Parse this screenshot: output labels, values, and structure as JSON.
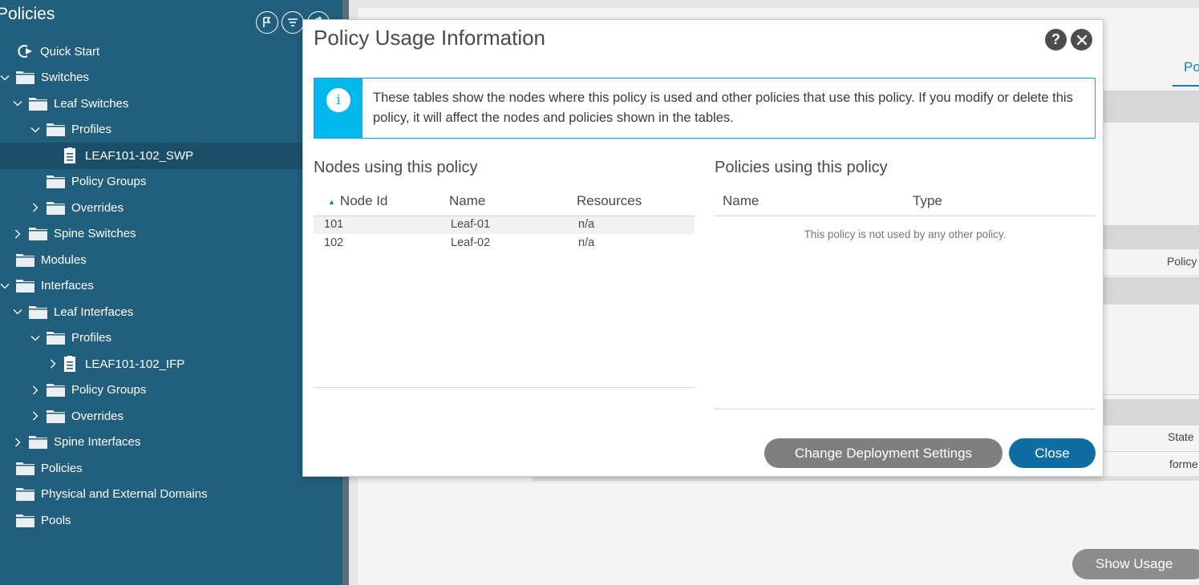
{
  "sidebar": {
    "title": "Policies",
    "items": [
      {
        "label": "Quick Start",
        "level": 0,
        "chevron": "none",
        "icon": "quick-start-icon"
      },
      {
        "label": "Switches",
        "level": 0,
        "chevron": "down",
        "icon": "folder-icon"
      },
      {
        "label": "Leaf Switches",
        "level": 1,
        "chevron": "down",
        "icon": "folder-icon"
      },
      {
        "label": "Profiles",
        "level": 2,
        "chevron": "down",
        "icon": "folder-icon"
      },
      {
        "label": "LEAF101-102_SWP",
        "level": 3,
        "chevron": "none",
        "icon": "document-icon",
        "selected": true
      },
      {
        "label": "Policy Groups",
        "level": 2,
        "chevron": "none",
        "icon": "folder-icon"
      },
      {
        "label": "Overrides",
        "level": 2,
        "chevron": "right",
        "icon": "folder-icon"
      },
      {
        "label": "Spine Switches",
        "level": 1,
        "chevron": "right",
        "icon": "folder-icon"
      },
      {
        "label": "Modules",
        "level": 0,
        "chevron": "none",
        "icon": "folder-icon"
      },
      {
        "label": "Interfaces",
        "level": 0,
        "chevron": "down",
        "icon": "folder-icon"
      },
      {
        "label": "Leaf Interfaces",
        "level": 1,
        "chevron": "down",
        "icon": "folder-icon"
      },
      {
        "label": "Profiles",
        "level": 2,
        "chevron": "down",
        "icon": "folder-icon"
      },
      {
        "label": "LEAF101-102_IFP",
        "level": 3,
        "chevron": "right",
        "icon": "document-icon"
      },
      {
        "label": "Policy Groups",
        "level": 2,
        "chevron": "right",
        "icon": "folder-icon"
      },
      {
        "label": "Overrides",
        "level": 2,
        "chevron": "right",
        "icon": "folder-icon"
      },
      {
        "label": "Spine Interfaces",
        "level": 1,
        "chevron": "right",
        "icon": "folder-icon"
      },
      {
        "label": "Policies",
        "level": 0,
        "chevron": "none",
        "icon": "folder-icon"
      },
      {
        "label": "Physical and External Domains",
        "level": 0,
        "chevron": "none",
        "icon": "folder-icon"
      },
      {
        "label": "Pools",
        "level": 0,
        "chevron": "none",
        "icon": "folder-icon"
      }
    ]
  },
  "background": {
    "tab_label": "Po",
    "col_policy": "Policy",
    "col_state": "State",
    "cell_forme": "forme",
    "show_usage_label": "Show Usage"
  },
  "modal": {
    "title": "Policy Usage Information",
    "help_label": "?",
    "info_text": "These tables show the nodes where this policy is used and other policies that use this policy. If you modify or delete this policy, it will affect the nodes and policies shown in the tables.",
    "nodes": {
      "title": "Nodes using this policy",
      "columns": [
        "Node Id",
        "Name",
        "Resources"
      ],
      "rows": [
        {
          "node_id": "101",
          "name": "Leaf-01",
          "resources": "n/a"
        },
        {
          "node_id": "102",
          "name": "Leaf-02",
          "resources": "n/a"
        }
      ]
    },
    "policies": {
      "title": "Policies using this policy",
      "columns": [
        "Name",
        "Type"
      ],
      "empty_message": "This policy is not used by any other policy."
    },
    "buttons": {
      "change_deployment": "Change Deployment Settings",
      "close": "Close"
    }
  },
  "colors": {
    "sidebar_bg": "#215f7c",
    "selected_bg": "#1b4f69",
    "info_accent": "#00b7ee",
    "primary_button": "#0e6ea4",
    "secondary_button": "#7f7f7f"
  }
}
